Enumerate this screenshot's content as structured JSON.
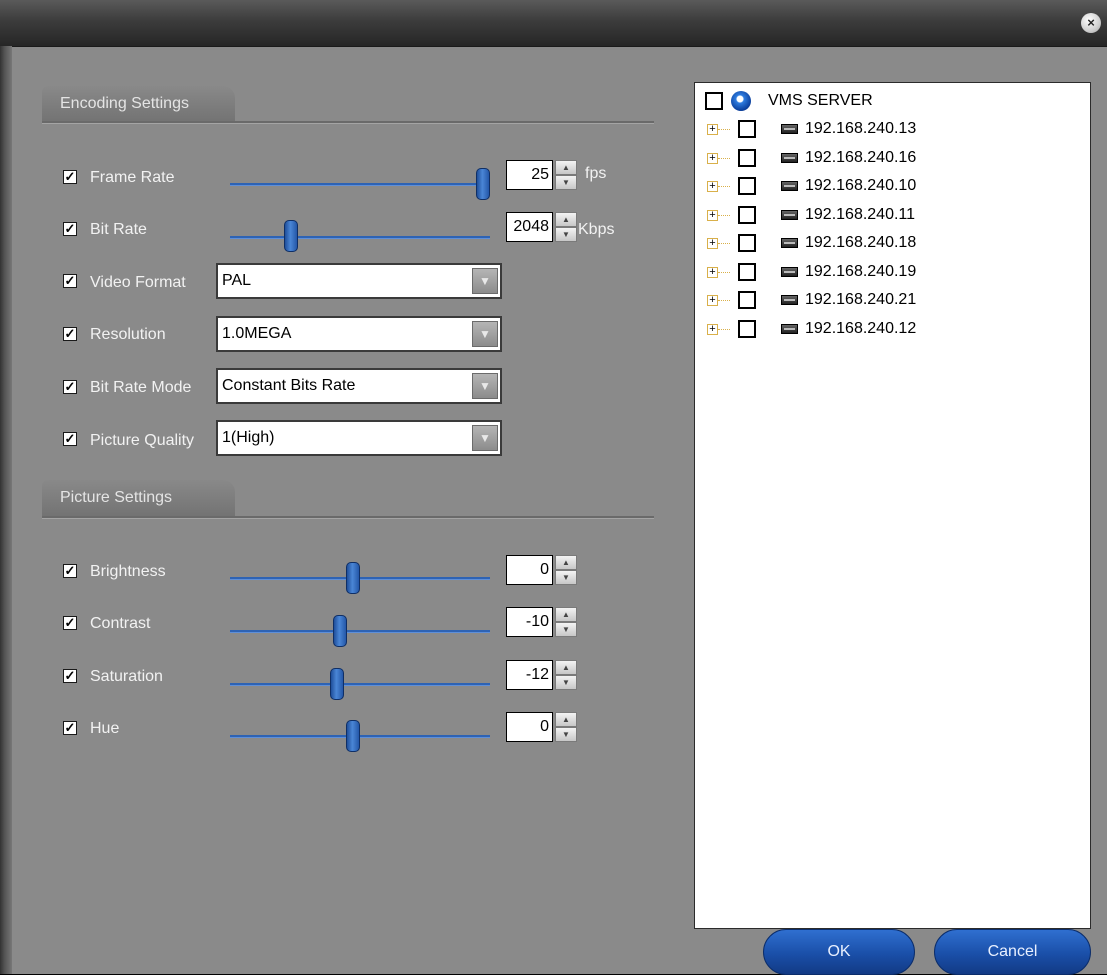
{
  "dialog": {
    "close_label": "×"
  },
  "encoding": {
    "title": "Encoding Settings",
    "frame_rate": {
      "label": "Frame Rate",
      "checked": true,
      "value": "25",
      "unit": "fps",
      "position": 1.0
    },
    "bit_rate": {
      "label": "Bit Rate",
      "checked": true,
      "value": "2048",
      "unit": "Kbps",
      "position": 0.26
    },
    "video_format": {
      "label": "Video Format",
      "checked": true,
      "value": "PAL"
    },
    "resolution": {
      "label": "Resolution",
      "checked": true,
      "value": "1.0MEGA"
    },
    "bit_rate_mode": {
      "label": "Bit Rate Mode",
      "checked": true,
      "value": "Constant Bits Rate"
    },
    "picture_quality": {
      "label": "Picture Quality",
      "checked": true,
      "value": "1(High)"
    }
  },
  "picture": {
    "title": "Picture Settings",
    "brightness": {
      "label": "Brightness",
      "checked": true,
      "value": "0",
      "position": 0.5
    },
    "contrast": {
      "label": "Contrast",
      "checked": true,
      "value": "-10",
      "position": 0.45
    },
    "saturation": {
      "label": "Saturation",
      "checked": true,
      "value": "-12",
      "position": 0.44
    },
    "hue": {
      "label": "Hue",
      "checked": true,
      "value": "0",
      "position": 0.5
    }
  },
  "tree": {
    "root": {
      "label": "VMS SERVER",
      "icon": "globe-icon",
      "checked": false
    },
    "devices": [
      {
        "label": "192.168.240.13",
        "icon": "device-icon",
        "checked": false
      },
      {
        "label": "192.168.240.16",
        "icon": "device-icon",
        "checked": false
      },
      {
        "label": "192.168.240.10",
        "icon": "device-icon",
        "checked": false
      },
      {
        "label": "192.168.240.11",
        "icon": "device-icon",
        "checked": false
      },
      {
        "label": "192.168.240.18",
        "icon": "device-icon",
        "checked": false
      },
      {
        "label": "192.168.240.19",
        "icon": "device-icon",
        "checked": false
      },
      {
        "label": "192.168.240.21",
        "icon": "device-icon",
        "checked": false
      },
      {
        "label": "192.168.240.12",
        "icon": "device-icon",
        "checked": false
      }
    ]
  },
  "buttons": {
    "ok_label": "OK",
    "cancel_label": "Cancel"
  },
  "colors": {
    "dialog_bg": "#8a8a8a",
    "slider_blue": "#2e63b4",
    "button_blue": "#1a4fa8"
  }
}
